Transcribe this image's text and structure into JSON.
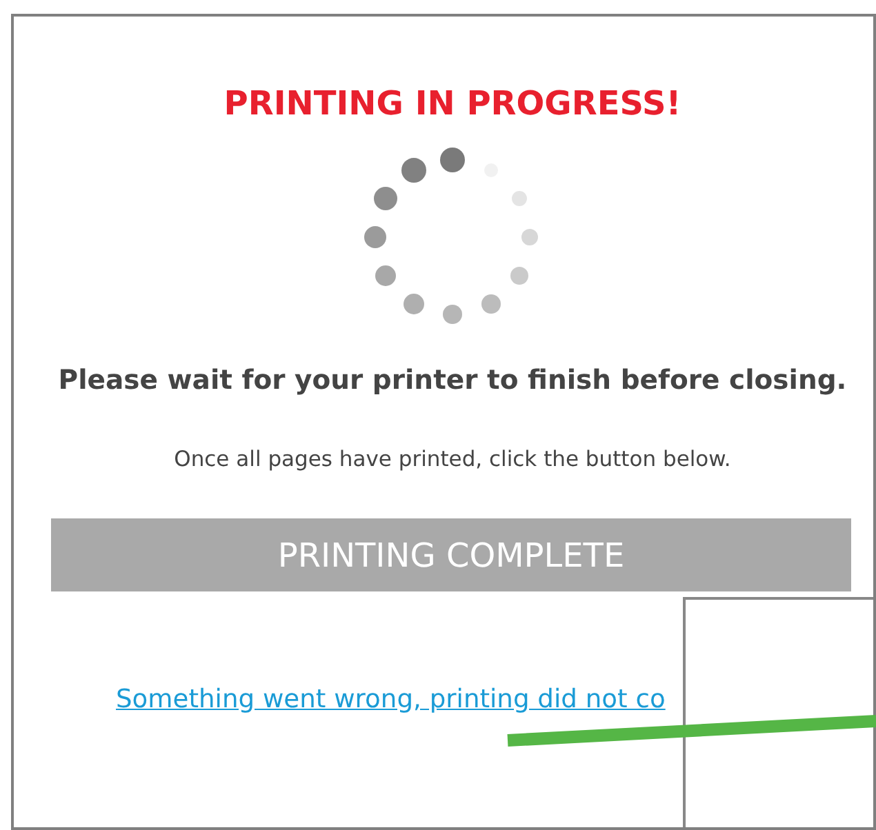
{
  "title": "PRINTING IN PROGRESS!",
  "message": "Please wait for your printer to finish before closing.",
  "hint": "Once all pages have printed, click the button below.",
  "button": "PRINTING COMPLETE",
  "link": "Something went wrong, printing did not co"
}
